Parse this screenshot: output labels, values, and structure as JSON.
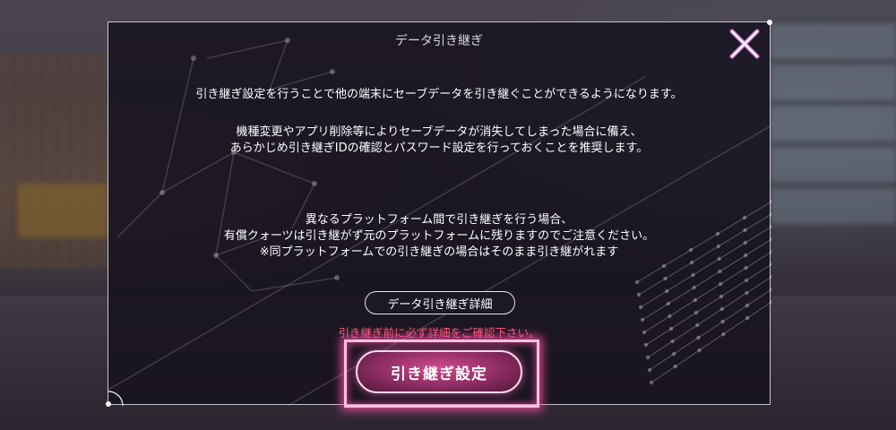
{
  "dialog": {
    "title": "データ引き継ぎ",
    "close_icon": "close-x-icon",
    "paragraph1": "引き継ぎ設定を行うことで他の端末にセーブデータを引き継ぐことができるようになります。",
    "paragraph2_lines": [
      "機種変更やアプリ削除等によりセーブデータが消失してしまった場合に備え、",
      "あらかじめ引き継ぎIDの確認とパスワード設定を行っておくことを推奨します。"
    ],
    "paragraph3_lines": [
      "異なるプラットフォーム間で引き継ぎを行う場合、",
      "有償クォーツは引き継がず元のプラットフォームに残りますのでご注意ください。",
      "※同プラットフォームでの引き継ぎの場合はそのまま引き継がれます"
    ],
    "detail_button_label": "データ引き継ぎ詳細",
    "warning_text": "引き継ぎ前に必ず詳細をご確認下さい。",
    "setup_button_label": "引き継ぎ設定"
  },
  "colors": {
    "accent_pink": "#d04a8e",
    "warning_red": "#ff5a72",
    "highlight": "#ffc2dc"
  }
}
